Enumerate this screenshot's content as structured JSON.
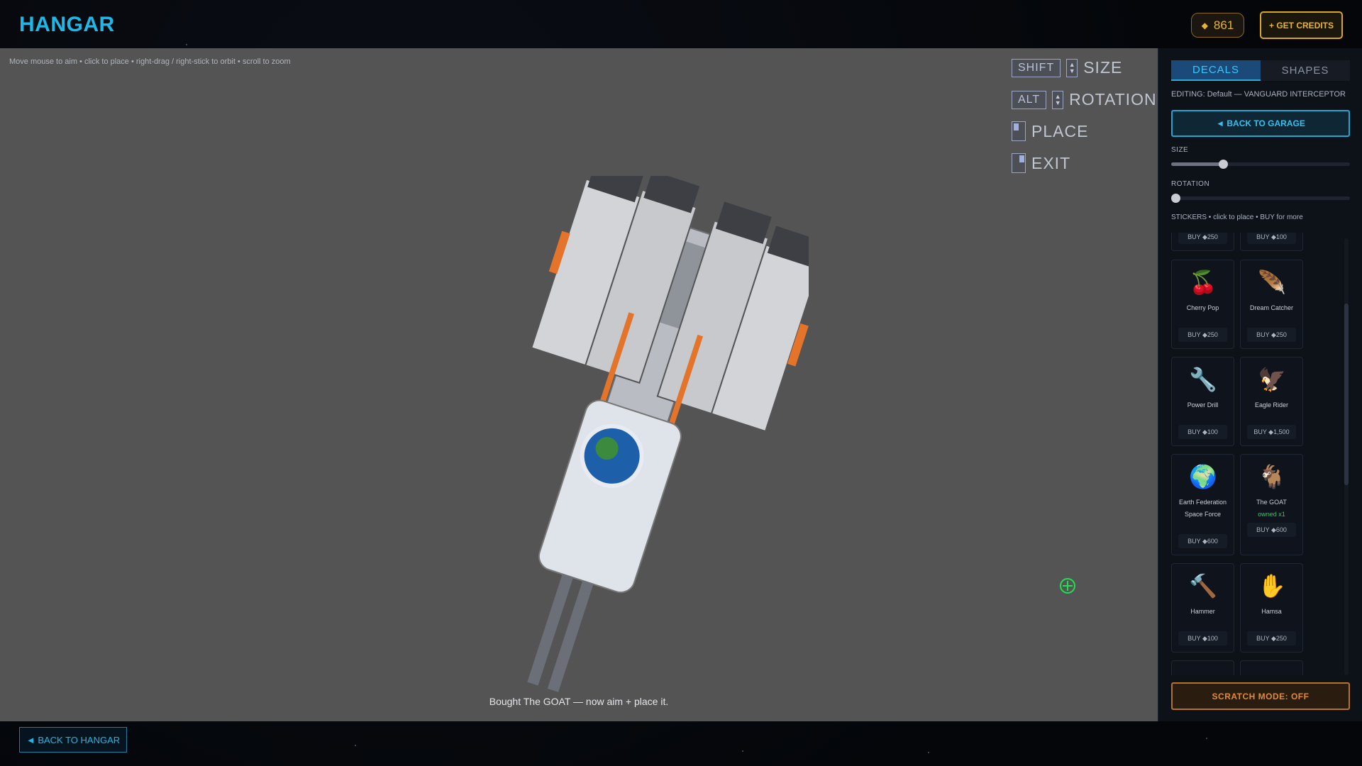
{
  "header": {
    "title": "HANGAR",
    "credits": "861",
    "credits_icon": "diamond-icon",
    "get_credits_label": "+ GET CREDITS"
  },
  "viewport": {
    "hint": "Move mouse to aim • click to place • right-drag / right-stick to orbit • scroll to zoom",
    "controls": [
      {
        "key": "SHIFT",
        "label": "SIZE"
      },
      {
        "key": "ALT",
        "label": "ROTATION"
      },
      {
        "key": "",
        "label": "PLACE"
      },
      {
        "key": "",
        "label": "EXIT"
      }
    ],
    "status": "Bought The GOAT — now aim + place it."
  },
  "footer": {
    "back_label": "◄ BACK TO HANGAR"
  },
  "panel": {
    "tabs": [
      "DECALS",
      "SHAPES"
    ],
    "active_tab": "DECALS",
    "editing": "EDITING: Default — VANGUARD INTERCEPTOR",
    "back_label": "◄ BACK TO GARAGE",
    "size_label": "SIZE",
    "size_value": 0.29,
    "rotation_label": "ROTATION",
    "rotation_value": 0.0,
    "stickers_label": "STICKERS  •  click to place  •  BUY for more",
    "stickers": [
      {
        "name": "",
        "owned": "",
        "buy": "BUY ◆250",
        "icon": "partial-sticker"
      },
      {
        "name": "",
        "owned": "",
        "buy": "BUY ◆100",
        "icon": "partial-sticker"
      },
      {
        "name": "Cherry Pop",
        "owned": "",
        "buy": "BUY ◆250",
        "icon": "cherry-pinup-icon"
      },
      {
        "name": "Dream Catcher",
        "owned": "",
        "buy": "BUY ◆250",
        "icon": "dream-catcher-icon"
      },
      {
        "name": "Power Drill",
        "owned": "",
        "buy": "BUY ◆100",
        "icon": "power-drill-icon"
      },
      {
        "name": "Eagle Rider",
        "owned": "",
        "buy": "BUY ◆1,500",
        "icon": "eagle-icon"
      },
      {
        "name": "Earth Federation Space Force",
        "owned": "",
        "buy": "BUY ◆600",
        "icon": "space-force-emblem-icon"
      },
      {
        "name": "The GOAT",
        "owned": "owned x1",
        "buy": "BUY ◆600",
        "icon": "goat-icon"
      },
      {
        "name": "Hammer",
        "owned": "",
        "buy": "BUY ◆100",
        "icon": "hammer-icon"
      },
      {
        "name": "Hamsa",
        "owned": "",
        "buy": "BUY ◆250",
        "icon": "hamsa-icon"
      }
    ],
    "scratch_label": "SCRATCH MODE: OFF"
  }
}
